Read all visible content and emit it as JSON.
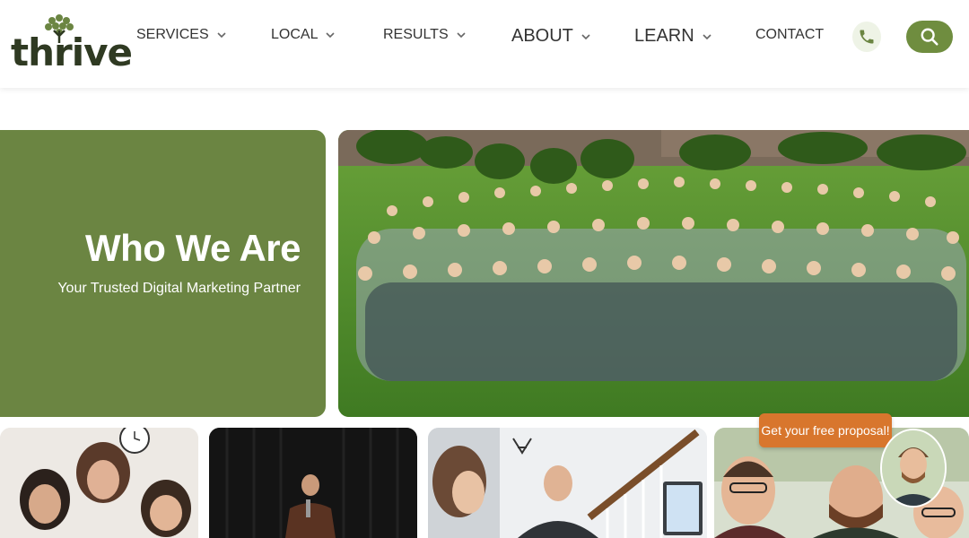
{
  "brand": {
    "name": "thrive"
  },
  "nav": {
    "items": [
      {
        "label": "SERVICES",
        "dropdown": true
      },
      {
        "label": "LOCAL",
        "dropdown": true
      },
      {
        "label": "RESULTS",
        "dropdown": true
      },
      {
        "label": "ABOUT",
        "dropdown": true
      },
      {
        "label": "LEARN",
        "dropdown": true
      },
      {
        "label": "CONTACT",
        "dropdown": false
      }
    ]
  },
  "icons": {
    "phone": "phone-icon",
    "search": "search-icon",
    "chevron": "chevron-down-icon"
  },
  "hero": {
    "title": "Who We Are",
    "subtitle": "Your Trusted Digital Marketing Partner"
  },
  "cta": {
    "proposal_label": "Get your free proposal!"
  },
  "colors": {
    "brand_green": "#6b8542",
    "search_green": "#6f8d3f",
    "cta_orange": "#d8762d",
    "text_dark": "#333333"
  }
}
